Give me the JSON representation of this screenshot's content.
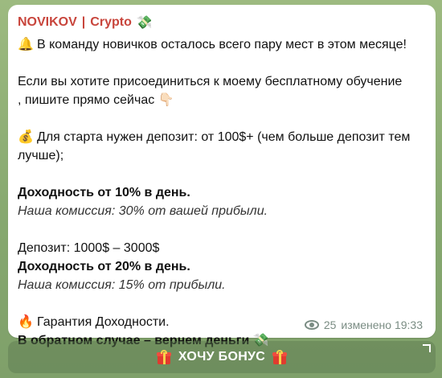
{
  "message": {
    "channel": "NOVIKOV",
    "separator": "|",
    "channel_suffix": "Crypto",
    "header_icon": "money-with-wings",
    "lines": {
      "l1_icon": "bell",
      "l1": "В команду новичков осталось всего пару мест в этом месяце!",
      "l2": "Если вы хотите присоединиться к моему бесплатному обучение",
      "l3": ", пишите прямо сейчас",
      "l3_icon": "pointing-down-hand",
      "l4_icon": "money-bag",
      "l4": "Для старта нужен депозит: от 100$+ (чем больше депозит тем",
      "l5": "лучше);",
      "l6": "Доходность от 10% в день.",
      "l7": "Наша комиссия: 30% от вашей прибыли.",
      "l8": "Депозит: 1000$ – 3000$",
      "l9": "Доходность от 20% в день.",
      "l10": "Наша комиссия: 15% от прибыли.",
      "l11_icon": "fire",
      "l11": "Гарантия Доходности.",
      "l12": "В обратном случае – вернем деньги",
      "l12_icon": "money-with-wings"
    },
    "meta": {
      "views": "25",
      "edited": "изменено 19:33"
    }
  },
  "bonus_button": {
    "label": "ХОЧУ БОНУС",
    "left_icon": "gift",
    "right_icon": "gift"
  }
}
